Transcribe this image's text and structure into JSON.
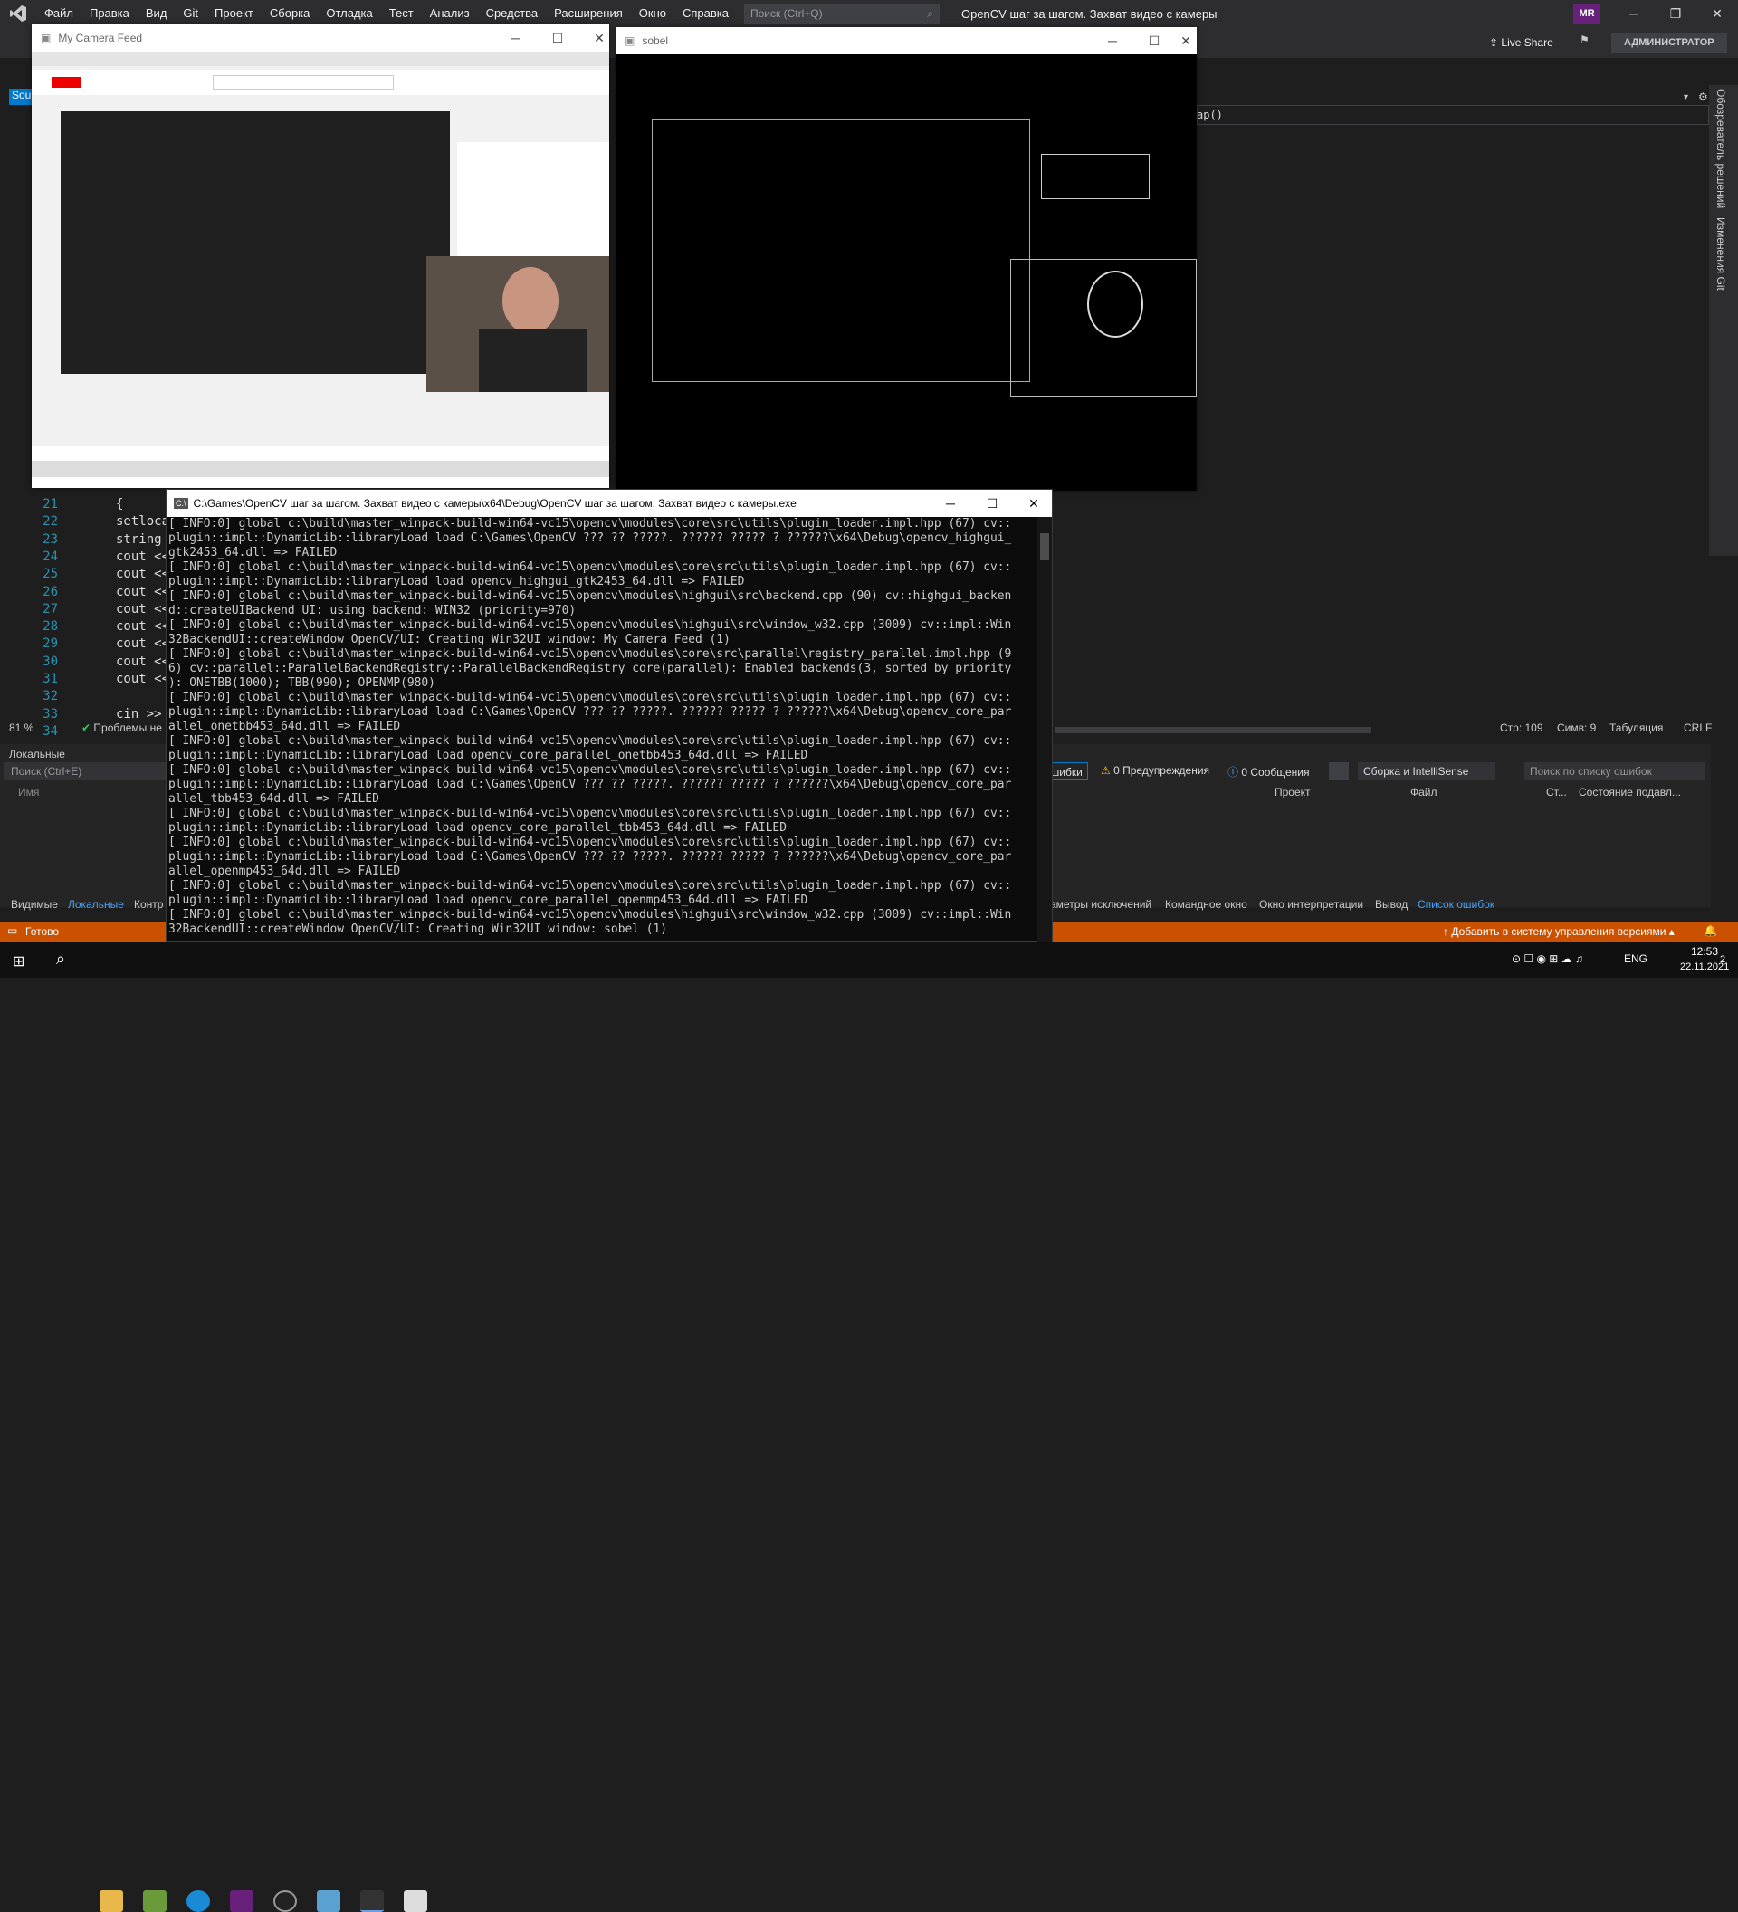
{
  "vs": {
    "menu": [
      "Файл",
      "Правка",
      "Вид",
      "Git",
      "Проект",
      "Сборка",
      "Отладка",
      "Тест",
      "Анализ",
      "Средства",
      "Расширения",
      "Окно",
      "Справка"
    ],
    "search_placeholder": "Поиск (Ctrl+Q)",
    "solution_title": "OpenCV шаг за шагом. Захват видео с камеры",
    "avatar": "MR",
    "live_share": "Live Share",
    "admin": "АДМИНИСТРАТОР",
    "side_tabs": [
      "Обозреватель решений",
      "Изменения Git"
    ],
    "editor_tab": "Sou",
    "func_hint": "ap()",
    "line_numbers": [
      "21",
      "22",
      "23",
      "24",
      "25",
      "26",
      "27",
      "28",
      "29",
      "30",
      "31",
      "32",
      "33",
      "34"
    ],
    "code_lines": [
      "{",
      "setloca",
      "string",
      "cout <<",
      "cout <<",
      "cout <<",
      "cout <<",
      "cout <<",
      "cout <<",
      "cout <<",
      "cout <<",
      "",
      "cin >>",
      ""
    ],
    "zoom": "81 %",
    "problems": "Проблемы не",
    "status_line": "Стр: 109",
    "status_col": "Симв: 9",
    "status_tab": "Табуляция",
    "status_crlf": "CRLF",
    "locals_title": "Локальные",
    "locals_search": "Поиск (Ctrl+E)",
    "locals_col": "Имя",
    "errors_label": "ошибки",
    "warnings": "0 Предупреждения",
    "messages": "0 Сообщения",
    "build_filter": "Сборка и IntelliSense",
    "error_search": "Поиск по списку ошибок",
    "err_cols": [
      "Проект",
      "Файл",
      "Ст...",
      "Состояние подавл..."
    ],
    "bottom_tabs_left": [
      "Видимые",
      "Локальные",
      "Контр"
    ],
    "bottom_tabs_right": [
      "аметры исключений",
      "Командное окно",
      "Окно интерпретации",
      "Вывод",
      "Список ошибок"
    ],
    "status_ready": "Готово",
    "status_add_vc": "Добавить в систему управления версиями"
  },
  "camera_window": {
    "title": "My Camera Feed"
  },
  "sobel_window": {
    "title": "sobel"
  },
  "console": {
    "title": "C:\\Games\\OpenCV шаг за шагом. Захват видео с камеры\\x64\\Debug\\OpenCV шаг за шагом. Захват видео с камеры.exe",
    "lines": [
      "[ INFO:0] global c:\\build\\master_winpack-build-win64-vc15\\opencv\\modules\\core\\src\\utils\\plugin_loader.impl.hpp (67) cv::",
      "plugin::impl::DynamicLib::libraryLoad load C:\\Games\\OpenCV ??? ?? ?????. ?????? ????? ? ??????\\x64\\Debug\\opencv_highgui_",
      "gtk2453_64.dll => FAILED",
      "[ INFO:0] global c:\\build\\master_winpack-build-win64-vc15\\opencv\\modules\\core\\src\\utils\\plugin_loader.impl.hpp (67) cv::",
      "plugin::impl::DynamicLib::libraryLoad load opencv_highgui_gtk2453_64.dll => FAILED",
      "[ INFO:0] global c:\\build\\master_winpack-build-win64-vc15\\opencv\\modules\\highgui\\src\\backend.cpp (90) cv::highgui_backen",
      "d::createUIBackend UI: using backend: WIN32 (priority=970)",
      "[ INFO:0] global c:\\build\\master_winpack-build-win64-vc15\\opencv\\modules\\highgui\\src\\window_w32.cpp (3009) cv::impl::Win",
      "32BackendUI::createWindow OpenCV/UI: Creating Win32UI window: My Camera Feed (1)",
      "[ INFO:0] global c:\\build\\master_winpack-build-win64-vc15\\opencv\\modules\\core\\src\\parallel\\registry_parallel.impl.hpp (9",
      "6) cv::parallel::ParallelBackendRegistry::ParallelBackendRegistry core(parallel): Enabled backends(3, sorted by priority",
      "): ONETBB(1000); TBB(990); OPENMP(980)",
      "[ INFO:0] global c:\\build\\master_winpack-build-win64-vc15\\opencv\\modules\\core\\src\\utils\\plugin_loader.impl.hpp (67) cv::",
      "plugin::impl::DynamicLib::libraryLoad load C:\\Games\\OpenCV ??? ?? ?????. ?????? ????? ? ??????\\x64\\Debug\\opencv_core_par",
      "allel_onetbb453_64d.dll => FAILED",
      "[ INFO:0] global c:\\build\\master_winpack-build-win64-vc15\\opencv\\modules\\core\\src\\utils\\plugin_loader.impl.hpp (67) cv::",
      "plugin::impl::DynamicLib::libraryLoad load opencv_core_parallel_onetbb453_64d.dll => FAILED",
      "[ INFO:0] global c:\\build\\master_winpack-build-win64-vc15\\opencv\\modules\\core\\src\\utils\\plugin_loader.impl.hpp (67) cv::",
      "plugin::impl::DynamicLib::libraryLoad load C:\\Games\\OpenCV ??? ?? ?????. ?????? ????? ? ??????\\x64\\Debug\\opencv_core_par",
      "allel_tbb453_64d.dll => FAILED",
      "[ INFO:0] global c:\\build\\master_winpack-build-win64-vc15\\opencv\\modules\\core\\src\\utils\\plugin_loader.impl.hpp (67) cv::",
      "plugin::impl::DynamicLib::libraryLoad load opencv_core_parallel_tbb453_64d.dll => FAILED",
      "[ INFO:0] global c:\\build\\master_winpack-build-win64-vc15\\opencv\\modules\\core\\src\\utils\\plugin_loader.impl.hpp (67) cv::",
      "plugin::impl::DynamicLib::libraryLoad load C:\\Games\\OpenCV ??? ?? ?????. ?????? ????? ? ??????\\x64\\Debug\\opencv_core_par",
      "allel_openmp453_64d.dll => FAILED",
      "[ INFO:0] global c:\\build\\master_winpack-build-win64-vc15\\opencv\\modules\\core\\src\\utils\\plugin_loader.impl.hpp (67) cv::",
      "plugin::impl::DynamicLib::libraryLoad load opencv_core_parallel_openmp453_64d.dll => FAILED",
      "[ INFO:0] global c:\\build\\master_winpack-build-win64-vc15\\opencv\\modules\\highgui\\src\\window_w32.cpp (3009) cv::impl::Win",
      "32BackendUI::createWindow OpenCV/UI: Creating Win32UI window: sobel (1)"
    ]
  },
  "taskbar": {
    "lang": "ENG",
    "time": "12:53",
    "date": "22.11.2021",
    "notif": "2"
  },
  "colors": {
    "accent": "#007acc",
    "status": "#ca5100",
    "vs_purple": "#68217a"
  }
}
